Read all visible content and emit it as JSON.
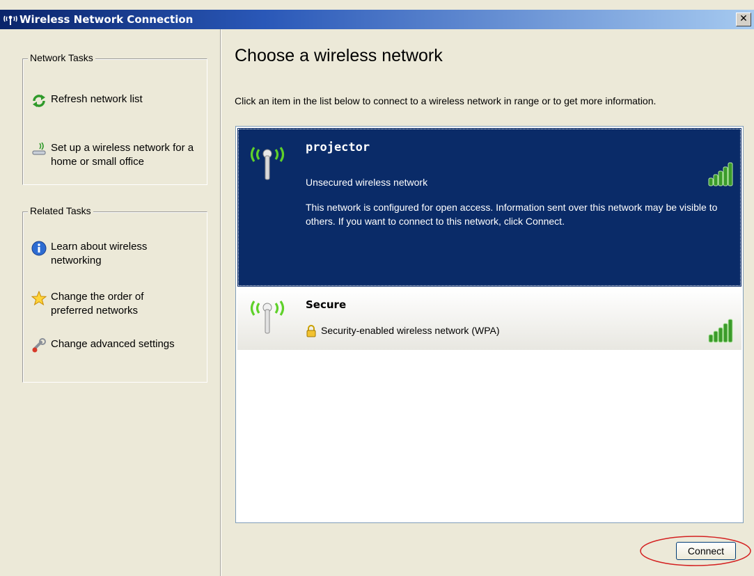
{
  "window": {
    "title": "Wireless Network Connection",
    "close_label": "✕"
  },
  "taskpane": {
    "network_tasks": {
      "title": "Network Tasks",
      "items": [
        {
          "label": "Refresh network list",
          "icon": "refresh-icon"
        },
        {
          "label": "Set up a wireless network for a home or small office",
          "icon": "setup-wireless-icon"
        }
      ]
    },
    "related_tasks": {
      "title": "Related Tasks",
      "items": [
        {
          "label": "Learn about wireless networking",
          "icon": "info-icon"
        },
        {
          "label": "Change the order of preferred networks",
          "icon": "star-icon"
        },
        {
          "label": "Change advanced settings",
          "icon": "settings-icon"
        }
      ]
    }
  },
  "main": {
    "title": "Choose a wireless network",
    "description": "Click an item in the list below to connect to a wireless network in range or to get more information.",
    "networks": [
      {
        "name": "projector",
        "status": "Unsecured wireless network",
        "info": "This network is configured for open access. Information sent over this network may be visible to others. If you want to connect to this network, click Connect.",
        "selected": true,
        "signal_bars": 5
      },
      {
        "name": "Secure",
        "status": "Security-enabled wireless network (WPA)",
        "selected": false,
        "signal_bars": 5
      }
    ],
    "connect_label": "Connect"
  },
  "colors": {
    "titlebar": "#0a246a",
    "selected_item": "#0a2b68",
    "signal_green": "#3a9b2a",
    "annotation_red": "#d42020"
  }
}
